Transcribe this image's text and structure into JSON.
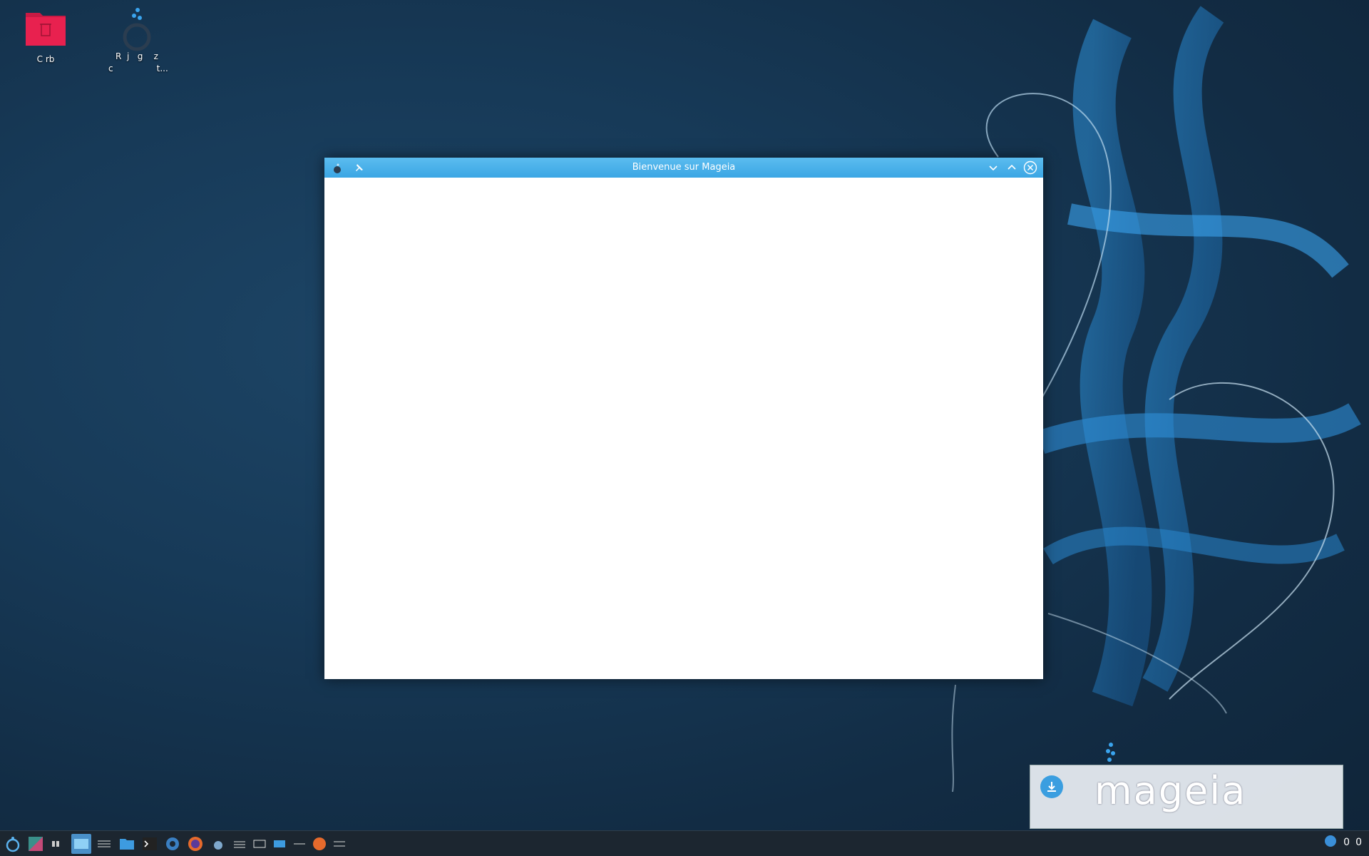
{
  "desktop": {
    "icons": [
      {
        "label": "C  rb"
      },
      {
        "label": "R  j   g    z\n c                t..."
      }
    ]
  },
  "window": {
    "title": "Bienvenue sur Mageia"
  },
  "notification": {
    "brand": "mageia"
  },
  "tray": {
    "items": [
      "0",
      "0"
    ]
  },
  "colors": {
    "titlebar": "#3ba6e4",
    "trash": "#e8214f",
    "accent": "#4a90c8"
  },
  "icons": {
    "trash": "trash-icon",
    "mageia": "mageia-logo-icon",
    "pin": "pin-icon",
    "minimize": "chevron-down-icon",
    "maximize": "chevron-up-icon",
    "close": "close-icon"
  }
}
